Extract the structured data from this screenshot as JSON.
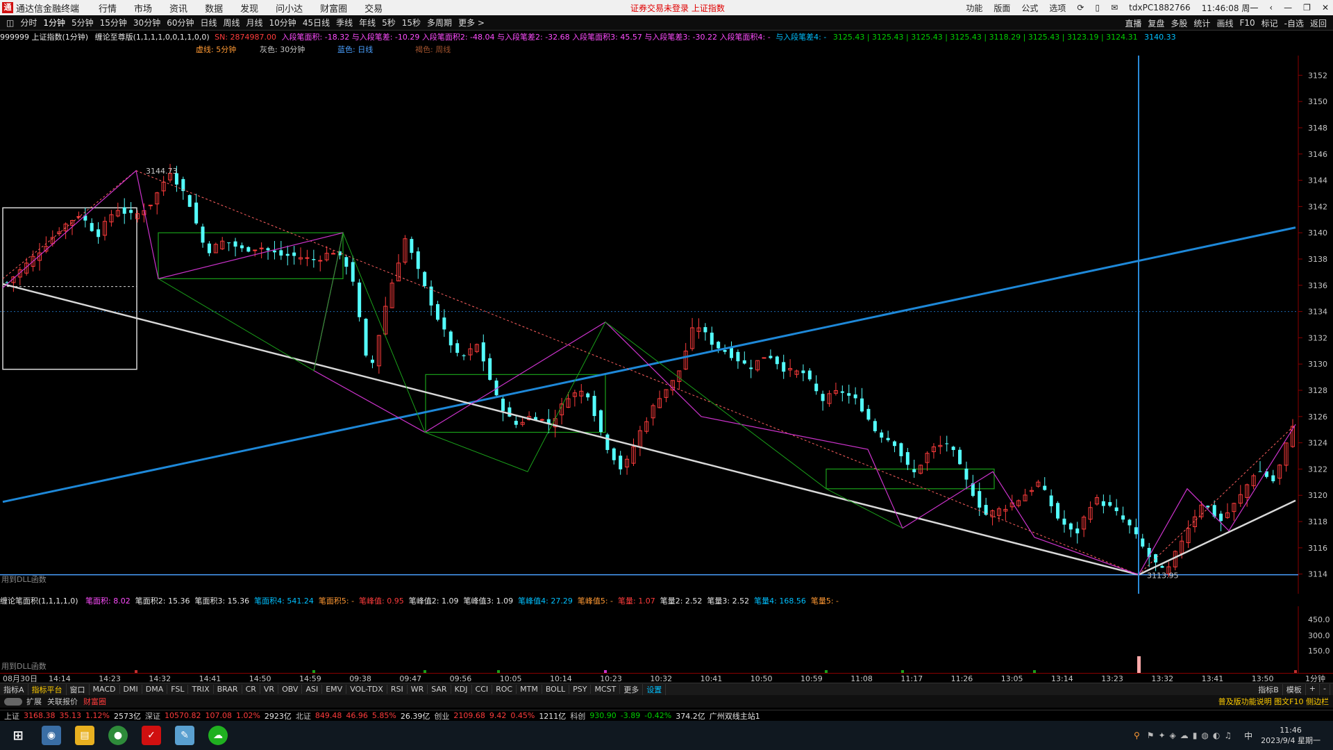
{
  "app": {
    "name": "通达信金融终端",
    "menus": [
      "行情",
      "市场",
      "资讯",
      "数据",
      "发现",
      "问小达",
      "财富圈",
      "交易"
    ],
    "notice": "证券交易未登录  上证指数",
    "right_menus": [
      "功能",
      "版面",
      "公式",
      "选项"
    ],
    "account": "tdxPC1882766",
    "clock": "11:46:08 周一"
  },
  "toolbar": {
    "periods": [
      "分时",
      "1分钟",
      "5分钟",
      "15分钟",
      "30分钟",
      "60分钟",
      "日线",
      "周线",
      "月线",
      "10分钟",
      "45日线",
      "季线",
      "年线",
      "5秒",
      "15秒",
      "多周期",
      "更多 >"
    ],
    "right_items": [
      "直播",
      "复盘",
      "多股",
      "统计",
      "画线",
      "F10",
      "标记",
      "-自选",
      "返回"
    ]
  },
  "info": {
    "security": "999999 上证指数(1分钟)",
    "indicator": "缠论至尊版(1,1,1,1,0,0,1,1,0,0)",
    "sn": "SN: 2874987.00",
    "values": "入段笔面积: -18.32 与入段笔差: -10.29 入段笔面积2: -48.04 与入段笔差2: -32.68 入段笔面积3: 45.57 与入段笔差3: -30.22 入段笔面积4: -",
    "tail": "与入段笔差4: -",
    "prices": "3125.43 | 3125.43 | 3125.43 | 3125.43 | 3118.29 | 3125.43 | 3123.19 | 3124.31",
    "last": "3140.33"
  },
  "legend": [
    {
      "label": "虚线: 5分钟",
      "color": "#ff9933"
    },
    {
      "label": "灰色: 30分钟",
      "color": "#c8c8c8"
    },
    {
      "label": "蓝色: 日线",
      "color": "#4aa0ff"
    },
    {
      "label": "褐色: 周线",
      "color": "#a0522d"
    }
  ],
  "chart_note_main": "用到DLL函数",
  "chart_data": {
    "type": "candlestick",
    "title": "999999 上证指数(1分钟)",
    "ylim": [
      3112.5,
      3153.5
    ],
    "yticks": [
      3114,
      3116,
      3118,
      3120,
      3122,
      3124,
      3126,
      3128,
      3130,
      3132,
      3134,
      3136,
      3138,
      3140,
      3142,
      3144,
      3146,
      3148,
      3150,
      3152
    ],
    "high_label": "3144.73",
    "low_label": "3113.95",
    "time_labels": [
      "08月30日",
      "14:14",
      "14:23",
      "14:32",
      "14:41",
      "14:50",
      "14:59",
      "09:38",
      "09:47",
      "09:56",
      "10:05",
      "10:14",
      "10:23",
      "10:32",
      "10:41",
      "10:50",
      "10:59",
      "11:08",
      "11:17",
      "11:26",
      "13:05",
      "13:14",
      "13:23",
      "13:32",
      "13:41",
      "13:50",
      "1分钟"
    ],
    "close_path": [
      3136.2,
      3137.5,
      3138.9,
      3140.4,
      3141.4,
      3139.8,
      3141.9,
      3141.2,
      3142.3,
      3144.73,
      3142.5,
      3138.5,
      3139.4,
      3138.7,
      3138.9,
      3138.3,
      3138.2,
      3137.9,
      3138.6,
      3137.2,
      3129.0,
      3135.0,
      3139.6,
      3136.0,
      3132.8,
      3130.3,
      3131.5,
      3127.5,
      3125.3,
      3126.1,
      3125.4,
      3127.6,
      3128.0,
      3124.0,
      3121.8,
      3125.0,
      3127.5,
      3129.0,
      3133.2,
      3131.5,
      3130.7,
      3129.7,
      3130.8,
      3129.5,
      3129.3,
      3127.2,
      3128.0,
      3127.1,
      3124.8,
      3124.0,
      3121.5,
      3123.5,
      3124.0,
      3121.0,
      3118.5,
      3119.0,
      3119.8,
      3121.0,
      3118.3,
      3116.9,
      3119.8,
      3119.0,
      3117.6,
      3115.4,
      3113.95,
      3117.0,
      3119.5,
      3118.0,
      3119.7,
      3122.0,
      3121.0,
      3125.43
    ],
    "volume_axis": [
      450.0,
      300.0,
      150.0
    ]
  },
  "indicator_pane": {
    "name": "缠论笔面积(1,1,1,1,0)",
    "values": [
      {
        "t": "笔面积: 8.02",
        "c": "#ff4dff"
      },
      {
        "t": "笔面积2: 15.36",
        "c": "#e8e8e8"
      },
      {
        "t": "笔面积3: 15.36",
        "c": "#e8e8e8"
      },
      {
        "t": "笔面积4: 541.24",
        "c": "#00c0ff"
      },
      {
        "t": "笔面积5: -",
        "c": "#ff9933"
      },
      {
        "t": "笔峰值: 0.95",
        "c": "#ff3c3c"
      },
      {
        "t": "笔峰值2: 1.09",
        "c": "#e8e8e8"
      },
      {
        "t": "笔峰值3: 1.09",
        "c": "#e8e8e8"
      },
      {
        "t": "笔峰值4: 27.29",
        "c": "#00c0ff"
      },
      {
        "t": "笔峰值5: -",
        "c": "#ff9933"
      },
      {
        "t": "笔量: 1.07",
        "c": "#ff3c3c"
      },
      {
        "t": "笔量2: 2.52",
        "c": "#e8e8e8"
      },
      {
        "t": "笔量3: 2.52",
        "c": "#e8e8e8"
      },
      {
        "t": "笔量4: 168.56",
        "c": "#00c0ff"
      },
      {
        "t": "笔量5: -",
        "c": "#ff9933"
      }
    ],
    "note": "用到DLL函数"
  },
  "indicator_tabs": [
    "指标A",
    "指标平台",
    "窗口",
    "MACD",
    "DMI",
    "DMA",
    "FSL",
    "TRIX",
    "BRAR",
    "CR",
    "VR",
    "OBV",
    "ASI",
    "EMV",
    "VOL-TDX",
    "RSI",
    "WR",
    "SAR",
    "KDJ",
    "CCI",
    "ROC",
    "MTM",
    "BOLL",
    "PSY",
    "MCST",
    "更多",
    "设置"
  ],
  "indicator_tabs_right": [
    "指标B",
    "模板",
    "+",
    "-"
  ],
  "sub_tabs": [
    "扩展",
    "关联报价",
    "财富圈"
  ],
  "sub_right": "普及版功能说明  图文F10 侧边栏",
  "statusbar": [
    {
      "t": "上证",
      "c": "#c8c8c8"
    },
    {
      "t": "3168.38",
      "c": "#ff3c3c"
    },
    {
      "t": "35.13",
      "c": "#ff3c3c"
    },
    {
      "t": "1.12%",
      "c": "#ff3c3c"
    },
    {
      "t": "2573亿",
      "c": "#e8e8e8"
    },
    {
      "t": "深证",
      "c": "#c8c8c8"
    },
    {
      "t": "10570.82",
      "c": "#ff3c3c"
    },
    {
      "t": "107.08",
      "c": "#ff3c3c"
    },
    {
      "t": "1.02%",
      "c": "#ff3c3c"
    },
    {
      "t": "2923亿",
      "c": "#e8e8e8"
    },
    {
      "t": "北证",
      "c": "#c8c8c8"
    },
    {
      "t": "849.48",
      "c": "#ff3c3c"
    },
    {
      "t": "46.96",
      "c": "#ff3c3c"
    },
    {
      "t": "5.85%",
      "c": "#ff3c3c"
    },
    {
      "t": "26.39亿",
      "c": "#e8e8e8"
    },
    {
      "t": "创业",
      "c": "#c8c8c8"
    },
    {
      "t": "2109.68",
      "c": "#ff3c3c"
    },
    {
      "t": "9.42",
      "c": "#ff3c3c"
    },
    {
      "t": "0.45%",
      "c": "#ff3c3c"
    },
    {
      "t": "1211亿",
      "c": "#e8e8e8"
    },
    {
      "t": "科创",
      "c": "#c8c8c8"
    },
    {
      "t": "930.90",
      "c": "#00d000"
    },
    {
      "t": "-3.89",
      "c": "#00d000"
    },
    {
      "t": "-0.42%",
      "c": "#00d000"
    },
    {
      "t": "374.2亿",
      "c": "#e8e8e8"
    },
    {
      "t": "广州双线主站1",
      "c": "#e8e8e8"
    }
  ],
  "taskbar": {
    "time": "11:46",
    "date": "2023/9/4 星期一",
    "ime": "中"
  }
}
